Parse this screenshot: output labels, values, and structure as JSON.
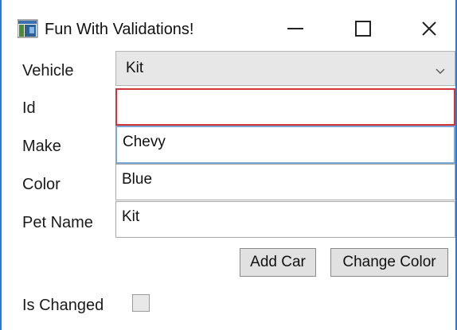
{
  "window": {
    "title": "Fun With Validations!",
    "controls": {
      "minimize_icon": "minimize-icon",
      "maximize_icon": "maximize-icon",
      "close_icon": "close-icon"
    }
  },
  "form": {
    "vehicle": {
      "label": "Vehicle",
      "value": "Kit"
    },
    "id": {
      "label": "Id",
      "value": "",
      "state": "invalid",
      "border_color": "#d13438"
    },
    "make": {
      "label": "Make",
      "value": "Chevy",
      "state": "focused",
      "border_color": "#7aa7d6"
    },
    "color": {
      "label": "Color",
      "value": "Blue"
    },
    "pet_name": {
      "label": "Pet Name",
      "value": "Kit"
    }
  },
  "buttons": {
    "add_car": "Add Car",
    "change_color": "Change Color"
  },
  "is_changed": {
    "label": "Is Changed",
    "checked": false
  },
  "colors": {
    "window_border": "#2b7bd6",
    "error_border": "#d13438",
    "focus_border": "#7aa7d6",
    "button_face": "#e1e1e1"
  }
}
